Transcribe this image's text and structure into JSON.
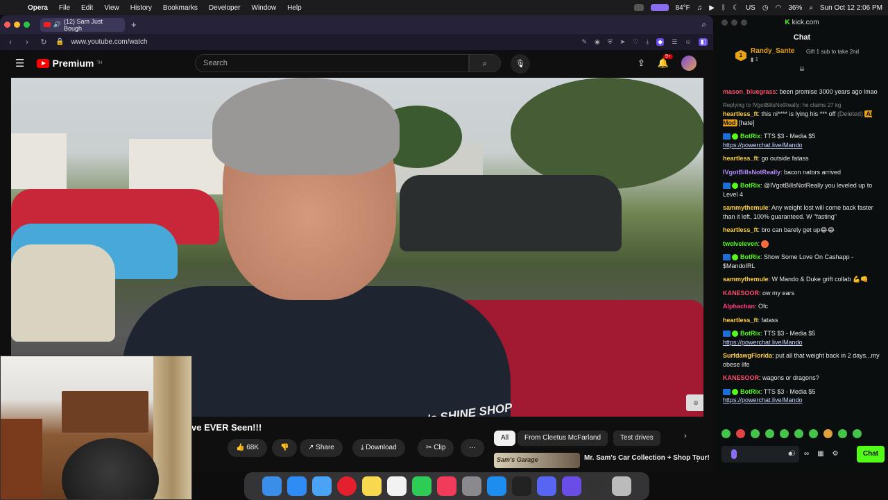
{
  "menubar": {
    "app": "Opera",
    "items": [
      "File",
      "Edit",
      "View",
      "History",
      "Bookmarks",
      "Developer",
      "Window",
      "Help"
    ],
    "temperature": "84°F",
    "battery": "36%",
    "clock": "Sun Oct 12  2:06 PM",
    "input_source": "US"
  },
  "browser": {
    "tab_title": "(12) Sam Just Bough",
    "url": "www.youtube.com/watch"
  },
  "youtube": {
    "logo_text": "Premium",
    "logo_sup": "TH",
    "search_placeholder": "Search",
    "notifications_badge": "9+",
    "video_title": "ve EVER Seen!!!",
    "likes": "68K",
    "share": "Share",
    "download": "Download",
    "clip": "Clip",
    "more": "···",
    "chips": [
      "All",
      "From Cleetus McFarland",
      "Test drives"
    ],
    "rec_title": "Mr. Sam's Car Collection + Shop Tour!",
    "rec_thumb_text": "Sam's Garage",
    "shirt_logo": "Mr. Sam's SHINE SHOP",
    "car_text": "het"
  },
  "kick": {
    "site": "kick.com",
    "chat_header": "Chat",
    "gifter": {
      "name": "Randy_Sante",
      "count": "1",
      "tier": "1",
      "text": "Gift 1 sub to take 2nd"
    },
    "messages": [
      {
        "user": "mason_bluegrass",
        "color": "#ff4d6d",
        "text": ": been promise 3000 years ago lmao"
      },
      {
        "reply": "Replying to IVgotBillsNotReally: he claims 27 kg",
        "user": "heartless_ft",
        "color": "#ffcf3d",
        "text": ": this ni**** is lying his *** off",
        "deleted": "(Deleted)",
        "mod": "AI Mod",
        "modtext": "[hate]"
      },
      {
        "bot": true,
        "user": "BotRix",
        "color": "#53fc18",
        "text": ": TTS $3 - Media $5",
        "link": "https://powerchat.live/Mando"
      },
      {
        "user": "heartless_ft",
        "color": "#ffcf3d",
        "text": ": go outside fatass"
      },
      {
        "user": "IVgotBillsNotReally",
        "color": "#b48cff",
        "text": ": bacon nators arrived"
      },
      {
        "bot": true,
        "user": "BotRix",
        "color": "#53fc18",
        "text": ": @IVgotBillsNotReally you leveled up to Level 4"
      },
      {
        "user": "sammythemule",
        "color": "#ffcf3d",
        "text": ": Any weight lost will come back faster than it left, 100% guaranteed. W \"fasting\""
      },
      {
        "user": "heartless_ft",
        "color": "#ffcf3d",
        "text": ": bro can barely get up😂😂"
      },
      {
        "user": "twelveleven",
        "color": "#53fc18",
        "text": ":"
      },
      {
        "bot": true,
        "user": "BotRix",
        "color": "#53fc18",
        "text": ": Show Some Love On Cashapp - $MandoIRL"
      },
      {
        "user": "sammythemule",
        "color": "#ffcf3d",
        "text": ": W Mando & Duke grift collab 💪👊"
      },
      {
        "user": "KANESOOR",
        "color": "#ff4d6d",
        "text": ": ow my ears"
      },
      {
        "user": "Alphachan",
        "color": "#ff3d7f",
        "text": ": Ofc"
      },
      {
        "user": "heartless_ft",
        "color": "#ffcf3d",
        "text": ": fatass"
      },
      {
        "bot": true,
        "user": "BotRix",
        "color": "#53fc18",
        "text": ": TTS $3 - Media $5",
        "link": "https://powerchat.live/Mando"
      },
      {
        "user": "SurfdawgFlorida",
        "color": "#ffcf3d",
        "text": ": put all that weight back in 2 days...my obese life"
      },
      {
        "user": "KANESOOR",
        "color": "#ff4d6d",
        "text": ": wagons or dragons?"
      },
      {
        "bot": true,
        "user": "BotRix",
        "color": "#53fc18",
        "text": ": TTS $3 - Media $5",
        "link": "https://powerchat.live/Mando"
      }
    ],
    "send_label": "Chat"
  }
}
